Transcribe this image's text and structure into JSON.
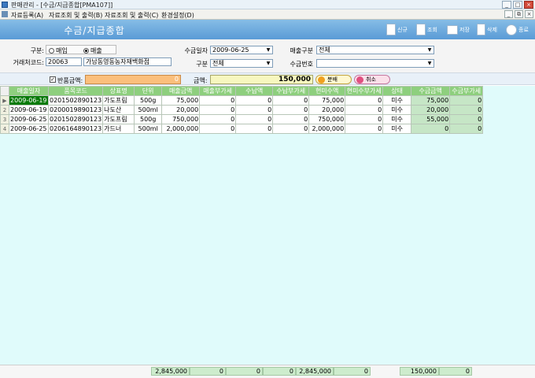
{
  "window": {
    "title": "판매관리 - [수금/지급종합[PMA107]]",
    "buttons": {
      "minimize": "_",
      "maximize": "□",
      "close": "×"
    },
    "mdi_buttons": {
      "minimize": "_",
      "restore": "⧉",
      "close": "×"
    }
  },
  "menu": {
    "items": [
      "자료등록(A)",
      "자료조회 및 출력(B)",
      "자료조회 및 출력(C)",
      "환경설정(D)"
    ]
  },
  "header": {
    "title": "수금/지급종합",
    "buttons": [
      {
        "label": "신규",
        "icon": "new-document-icon"
      },
      {
        "label": "조회",
        "icon": "search-document-icon"
      },
      {
        "label": "저장",
        "icon": "printer-icon"
      },
      {
        "label": "삭제",
        "icon": "trash-icon"
      },
      {
        "label": "종료",
        "icon": "power-icon"
      }
    ]
  },
  "form": {
    "type_label": "구분:",
    "type_options": [
      "매입",
      "매출"
    ],
    "type_selected": "매출",
    "date_label": "수금일자",
    "date_value": "2009-06-25",
    "sales_type_label": "매출구분",
    "sales_type_value": "전체",
    "client_label": "거래처코드:",
    "client_code": "20063",
    "client_name": "가남동영동농자재백화점",
    "category_label": "구분",
    "category_value": "전체",
    "receipt_no_label": "수금번호",
    "receipt_no_value": ""
  },
  "returnbar": {
    "checkbox_label": "반품금액:",
    "checked": true,
    "return_amount": "0",
    "amount_label": "금액:",
    "amount_value": "150,000",
    "apply_label": "분배",
    "cancel_label": "취소"
  },
  "grid": {
    "columns": [
      "매출일자",
      "품목코드",
      "상표명",
      "단위",
      "매출금액",
      "매출부가세",
      "수납액",
      "수납부가세",
      "현미수액",
      "현미수부가세",
      "상태",
      "수금금액",
      "수금부가세"
    ],
    "rows": [
      [
        "2009-06-19",
        "0201502890123",
        "가도프림",
        "500g",
        "75,000",
        "0",
        "0",
        "0",
        "75,000",
        "0",
        "미수",
        "75,000",
        "0"
      ],
      [
        "2009-06-19",
        "0200019890123",
        "나도산",
        "500ml",
        "20,000",
        "0",
        "0",
        "0",
        "20,000",
        "0",
        "미수",
        "20,000",
        "0"
      ],
      [
        "2009-06-25",
        "0201502890123",
        "가도프림",
        "500g",
        "750,000",
        "0",
        "0",
        "0",
        "750,000",
        "0",
        "미수",
        "55,000",
        "0"
      ],
      [
        "2009-06-25",
        "0206164890123",
        "가드너",
        "500ml",
        "2,000,000",
        "0",
        "0",
        "0",
        "2,000,000",
        "0",
        "미수",
        "0",
        "0"
      ]
    ],
    "row_numbers": [
      "▶",
      "2",
      "3",
      "4"
    ]
  },
  "footer": {
    "totals": [
      "2,845,000",
      "0",
      "0",
      "0",
      "2,845,000",
      "0",
      "150,000",
      "0"
    ]
  }
}
